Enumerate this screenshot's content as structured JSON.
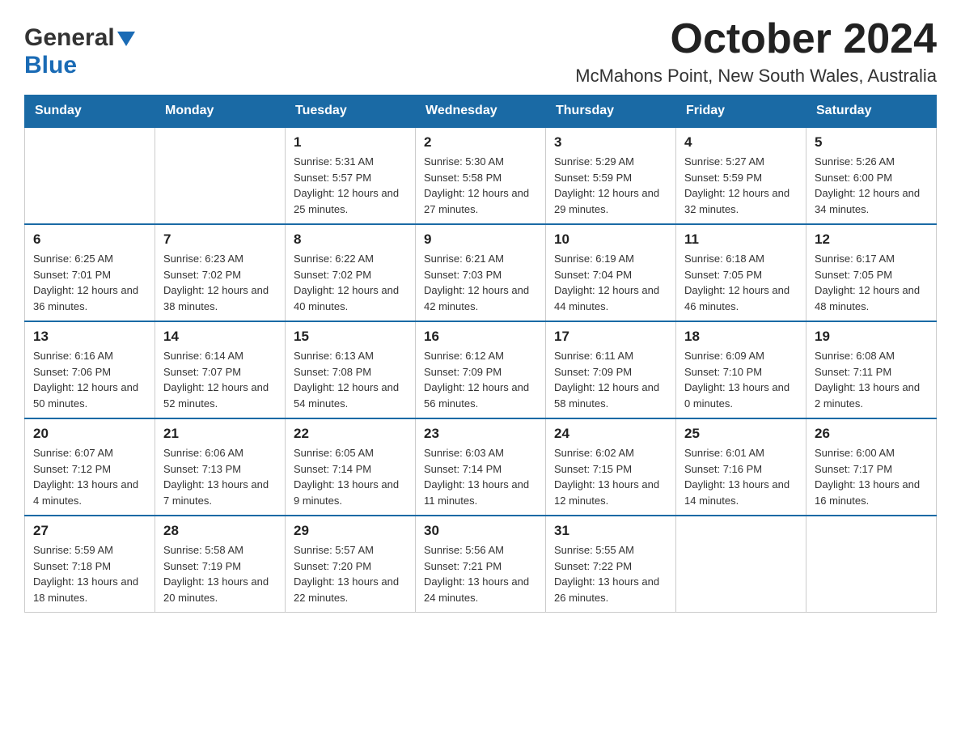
{
  "header": {
    "logo_general": "General",
    "logo_blue": "Blue",
    "month_title": "October 2024",
    "location": "McMahons Point, New South Wales, Australia"
  },
  "days_of_week": [
    "Sunday",
    "Monday",
    "Tuesday",
    "Wednesday",
    "Thursday",
    "Friday",
    "Saturday"
  ],
  "weeks": [
    [
      {
        "day": "",
        "sunrise": "",
        "sunset": "",
        "daylight": ""
      },
      {
        "day": "",
        "sunrise": "",
        "sunset": "",
        "daylight": ""
      },
      {
        "day": "1",
        "sunrise": "Sunrise: 5:31 AM",
        "sunset": "Sunset: 5:57 PM",
        "daylight": "Daylight: 12 hours and 25 minutes."
      },
      {
        "day": "2",
        "sunrise": "Sunrise: 5:30 AM",
        "sunset": "Sunset: 5:58 PM",
        "daylight": "Daylight: 12 hours and 27 minutes."
      },
      {
        "day": "3",
        "sunrise": "Sunrise: 5:29 AM",
        "sunset": "Sunset: 5:59 PM",
        "daylight": "Daylight: 12 hours and 29 minutes."
      },
      {
        "day": "4",
        "sunrise": "Sunrise: 5:27 AM",
        "sunset": "Sunset: 5:59 PM",
        "daylight": "Daylight: 12 hours and 32 minutes."
      },
      {
        "day": "5",
        "sunrise": "Sunrise: 5:26 AM",
        "sunset": "Sunset: 6:00 PM",
        "daylight": "Daylight: 12 hours and 34 minutes."
      }
    ],
    [
      {
        "day": "6",
        "sunrise": "Sunrise: 6:25 AM",
        "sunset": "Sunset: 7:01 PM",
        "daylight": "Daylight: 12 hours and 36 minutes."
      },
      {
        "day": "7",
        "sunrise": "Sunrise: 6:23 AM",
        "sunset": "Sunset: 7:02 PM",
        "daylight": "Daylight: 12 hours and 38 minutes."
      },
      {
        "day": "8",
        "sunrise": "Sunrise: 6:22 AM",
        "sunset": "Sunset: 7:02 PM",
        "daylight": "Daylight: 12 hours and 40 minutes."
      },
      {
        "day": "9",
        "sunrise": "Sunrise: 6:21 AM",
        "sunset": "Sunset: 7:03 PM",
        "daylight": "Daylight: 12 hours and 42 minutes."
      },
      {
        "day": "10",
        "sunrise": "Sunrise: 6:19 AM",
        "sunset": "Sunset: 7:04 PM",
        "daylight": "Daylight: 12 hours and 44 minutes."
      },
      {
        "day": "11",
        "sunrise": "Sunrise: 6:18 AM",
        "sunset": "Sunset: 7:05 PM",
        "daylight": "Daylight: 12 hours and 46 minutes."
      },
      {
        "day": "12",
        "sunrise": "Sunrise: 6:17 AM",
        "sunset": "Sunset: 7:05 PM",
        "daylight": "Daylight: 12 hours and 48 minutes."
      }
    ],
    [
      {
        "day": "13",
        "sunrise": "Sunrise: 6:16 AM",
        "sunset": "Sunset: 7:06 PM",
        "daylight": "Daylight: 12 hours and 50 minutes."
      },
      {
        "day": "14",
        "sunrise": "Sunrise: 6:14 AM",
        "sunset": "Sunset: 7:07 PM",
        "daylight": "Daylight: 12 hours and 52 minutes."
      },
      {
        "day": "15",
        "sunrise": "Sunrise: 6:13 AM",
        "sunset": "Sunset: 7:08 PM",
        "daylight": "Daylight: 12 hours and 54 minutes."
      },
      {
        "day": "16",
        "sunrise": "Sunrise: 6:12 AM",
        "sunset": "Sunset: 7:09 PM",
        "daylight": "Daylight: 12 hours and 56 minutes."
      },
      {
        "day": "17",
        "sunrise": "Sunrise: 6:11 AM",
        "sunset": "Sunset: 7:09 PM",
        "daylight": "Daylight: 12 hours and 58 minutes."
      },
      {
        "day": "18",
        "sunrise": "Sunrise: 6:09 AM",
        "sunset": "Sunset: 7:10 PM",
        "daylight": "Daylight: 13 hours and 0 minutes."
      },
      {
        "day": "19",
        "sunrise": "Sunrise: 6:08 AM",
        "sunset": "Sunset: 7:11 PM",
        "daylight": "Daylight: 13 hours and 2 minutes."
      }
    ],
    [
      {
        "day": "20",
        "sunrise": "Sunrise: 6:07 AM",
        "sunset": "Sunset: 7:12 PM",
        "daylight": "Daylight: 13 hours and 4 minutes."
      },
      {
        "day": "21",
        "sunrise": "Sunrise: 6:06 AM",
        "sunset": "Sunset: 7:13 PM",
        "daylight": "Daylight: 13 hours and 7 minutes."
      },
      {
        "day": "22",
        "sunrise": "Sunrise: 6:05 AM",
        "sunset": "Sunset: 7:14 PM",
        "daylight": "Daylight: 13 hours and 9 minutes."
      },
      {
        "day": "23",
        "sunrise": "Sunrise: 6:03 AM",
        "sunset": "Sunset: 7:14 PM",
        "daylight": "Daylight: 13 hours and 11 minutes."
      },
      {
        "day": "24",
        "sunrise": "Sunrise: 6:02 AM",
        "sunset": "Sunset: 7:15 PM",
        "daylight": "Daylight: 13 hours and 12 minutes."
      },
      {
        "day": "25",
        "sunrise": "Sunrise: 6:01 AM",
        "sunset": "Sunset: 7:16 PM",
        "daylight": "Daylight: 13 hours and 14 minutes."
      },
      {
        "day": "26",
        "sunrise": "Sunrise: 6:00 AM",
        "sunset": "Sunset: 7:17 PM",
        "daylight": "Daylight: 13 hours and 16 minutes."
      }
    ],
    [
      {
        "day": "27",
        "sunrise": "Sunrise: 5:59 AM",
        "sunset": "Sunset: 7:18 PM",
        "daylight": "Daylight: 13 hours and 18 minutes."
      },
      {
        "day": "28",
        "sunrise": "Sunrise: 5:58 AM",
        "sunset": "Sunset: 7:19 PM",
        "daylight": "Daylight: 13 hours and 20 minutes."
      },
      {
        "day": "29",
        "sunrise": "Sunrise: 5:57 AM",
        "sunset": "Sunset: 7:20 PM",
        "daylight": "Daylight: 13 hours and 22 minutes."
      },
      {
        "day": "30",
        "sunrise": "Sunrise: 5:56 AM",
        "sunset": "Sunset: 7:21 PM",
        "daylight": "Daylight: 13 hours and 24 minutes."
      },
      {
        "day": "31",
        "sunrise": "Sunrise: 5:55 AM",
        "sunset": "Sunset: 7:22 PM",
        "daylight": "Daylight: 13 hours and 26 minutes."
      },
      {
        "day": "",
        "sunrise": "",
        "sunset": "",
        "daylight": ""
      },
      {
        "day": "",
        "sunrise": "",
        "sunset": "",
        "daylight": ""
      }
    ]
  ]
}
